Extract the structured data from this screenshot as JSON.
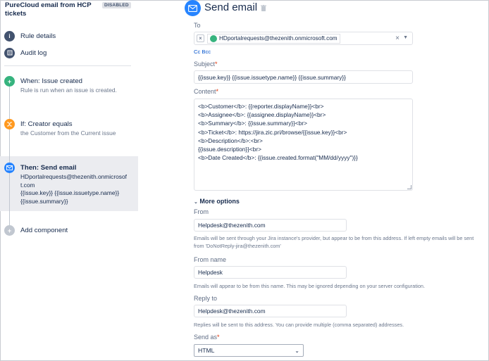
{
  "rule": {
    "title": "PureCloud email from HCP tickets",
    "status_badge": "DISABLED"
  },
  "nav": {
    "rule_details": "Rule details",
    "audit_log": "Audit log"
  },
  "steps": {
    "trigger": {
      "title": "When: Issue created",
      "desc": "Rule is run when an issue is created."
    },
    "condition": {
      "title": "If: Creator equals",
      "desc": "the Customer from the Current issue"
    },
    "action": {
      "title": "Then: Send email",
      "line1": "HDportalrequests@thezenith.onmicrosoft.com",
      "line2": "{{issue.key}} {{issue.issuetype.name}}",
      "line3": "{{issue.summary}}"
    },
    "add": {
      "title": "Add component"
    }
  },
  "editor": {
    "title": "Send email",
    "to": {
      "label": "To",
      "chip": "HDportalrequests@thezenith.onmicrosoft.com",
      "cc_bcc": "Cc Bcc"
    },
    "subject": {
      "label": "Subject",
      "value": "{{issue.key}} {{issue.issuetype.name}} {{issue.summary}}"
    },
    "content": {
      "label": "Content",
      "lines": [
        "<b>Customer</b>: {{reporter.displayName}}<br>",
        "<b>Assignee</b>: {{assignee.displayName}}<br>",
        "<b>Summary</b>: {{issue.summary}}<br>",
        "<b>Ticket</b>: https://jira.zic.pri/browse/{{issue.key}}<br>",
        "<b>Description</b>:<br>",
        "{{issue.description}}<br>",
        "<b>Date Created</b>: {{issue.created.format(\"MM/dd/yyyy\")}}"
      ]
    },
    "more_options": "More options",
    "from": {
      "label": "From",
      "value": "Helpdesk@thezenith.com",
      "help": "Emails will be sent through your Jira instance's provider, but appear to be from this address. If left empty emails will be sent from 'DoNotReply-jira@thezenith.com'"
    },
    "from_name": {
      "label": "From name",
      "value": "Helpdesk",
      "help": "Emails will appear to be from this name. This may be ignored depending on your server configuration."
    },
    "reply_to": {
      "label": "Reply to",
      "value": "Helpdesk@thezenith.com",
      "help": "Replies will be sent to this address. You can provide multiple (comma separated) addresses."
    },
    "send_as": {
      "label": "Send as",
      "value": "HTML"
    }
  },
  "colors": {
    "trigger": "#36b37e",
    "condition": "#ff991f",
    "action": "#2684ff",
    "add": "#c1c7d0",
    "nav_icon": "#42526e"
  }
}
